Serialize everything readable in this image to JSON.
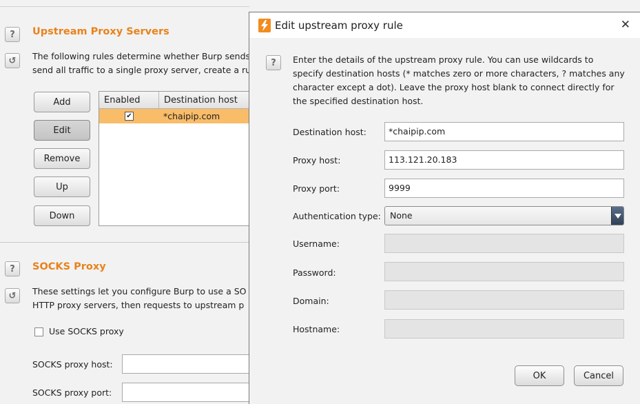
{
  "upstream": {
    "title": "Upstream Proxy Servers",
    "desc_line1": "The following rules determine whether Burp sends",
    "desc_line2": "send all traffic to a single proxy server, create a ru",
    "buttons": {
      "add": "Add",
      "edit": "Edit",
      "remove": "Remove",
      "up": "Up",
      "down": "Down"
    },
    "table": {
      "columns": [
        "Enabled",
        "Destination host"
      ],
      "rows": [
        {
          "enabled": "✔",
          "host": "*chaipip.com"
        }
      ]
    }
  },
  "socks": {
    "title": "SOCKS Proxy",
    "desc_line1": "These settings let you configure Burp to use a SO",
    "desc_line2": "HTTP proxy servers, then requests to upstream p",
    "use_label": "Use SOCKS proxy",
    "host_label": "SOCKS proxy host:",
    "port_label": "SOCKS proxy port:"
  },
  "icons": {
    "help": "?",
    "refresh": "↺"
  },
  "dialog": {
    "title": "Edit upstream proxy rule",
    "close": "✕",
    "intro": [
      "Enter the details of the upstream proxy rule. You can use wildcards to",
      "specify destination hosts (* matches zero or more characters, ? matches any",
      "character except a dot). Leave the proxy host blank to connect directly for",
      "the specified destination host."
    ],
    "labels": {
      "destination_host": "Destination host:",
      "proxy_host": "Proxy host:",
      "proxy_port": "Proxy port:",
      "auth_type": "Authentication type:",
      "username": "Username:",
      "password": "Password:",
      "domain": "Domain:",
      "hostname": "Hostname:"
    },
    "values": {
      "destination_host": "*chaipip.com",
      "proxy_host": "113.121.20.183",
      "proxy_port": "9999",
      "auth_type": "None"
    },
    "ok": "OK",
    "cancel": "Cancel"
  },
  "colors": {
    "accent": "#e8821c",
    "selected_row": "#f9bc68"
  }
}
